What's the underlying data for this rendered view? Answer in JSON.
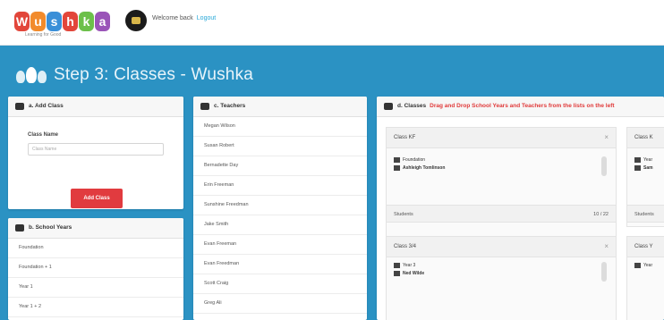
{
  "header": {
    "logo_letters": [
      "W",
      "u",
      "s",
      "h",
      "k",
      "a"
    ],
    "logo_colors": [
      "#e2463a",
      "#f28b2c",
      "#3a8fd8",
      "#e2463a",
      "#6cc04a",
      "#9a54b8"
    ],
    "logo_tagline": "Learning for Good",
    "welcome_text": "Welcome back",
    "welcome_link": "Logout"
  },
  "page": {
    "title": "Step 3: Classes - Wushka"
  },
  "add_class": {
    "heading": "a. Add Class",
    "field_label": "Class Name",
    "field_placeholder": "Class Name",
    "button_label": "Add Class"
  },
  "school_years": {
    "heading": "b. School Years",
    "items": [
      "Foundation",
      "Foundation + 1",
      "Year 1",
      "Year 1 + 2"
    ]
  },
  "teachers": {
    "heading": "c. Teachers",
    "items": [
      "Megan Wilson",
      "Susan Robert",
      "Bernadette Day",
      "Erin Freeman",
      "Sunshine Freedman",
      "Jake Smith",
      "Evan Freeman",
      "Evan Freedman",
      "Scott Craig",
      "Greg Ali"
    ]
  },
  "classes": {
    "heading": "d. Classes",
    "instruction": "Drag and Drop School Years and Teachers from the lists on the left",
    "cards": [
      {
        "name": "Class KF",
        "year": "Foundation",
        "teacher": "Ashleigh Tomlinson",
        "students_label": "Students",
        "students_value": "10 / 22"
      },
      {
        "name": "Class 3/4",
        "year": "Year 3",
        "teacher": "Ned Wilde",
        "students_label": "",
        "students_value": ""
      },
      {
        "name": "Class K",
        "year": "Year",
        "teacher": "Sam",
        "students_label": "Students",
        "students_value": ""
      },
      {
        "name": "Class Y",
        "year": "Year",
        "teacher": "",
        "students_label": "",
        "students_value": ""
      }
    ]
  },
  "colors": {
    "stage_blue": "#2b92c3",
    "button_red": "#e13b3f",
    "instruction_red": "#e03a3a",
    "link_blue": "#29a8d8"
  }
}
